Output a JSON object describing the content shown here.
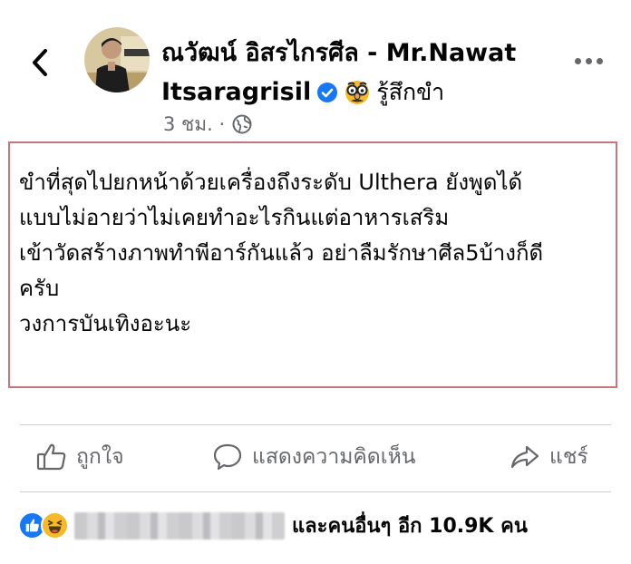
{
  "post": {
    "author_line1": "ณวัฒน์ อิสรไกรศีล - Mr.Nawat",
    "author_line2": "Itsaragrisil",
    "feeling": "รู้สึกขำ",
    "time": "3 ชม. ·",
    "lines": [
      "ขำที่สุดไปยกหน้าด้วยเครื่องถึงระดับ Ulthera ยังพูดได้",
      "แบบไม่อายว่าไม่เคยทำอะไรกินแต่อาหารเสริม",
      "เข้าวัดสร้างภาพทำพีอาร์กันแล้ว อย่าลืมรักษาศีล5บ้างก็ดี",
      "ครับ",
      "วงการบันเทิงอะนะ"
    ]
  },
  "icons": {
    "back": "chevron-left-icon",
    "verified": "verified-badge-icon",
    "feeling": "disguise-face-emoji-icon",
    "privacy": "globe-icon",
    "more": "more-dots-icon",
    "like": "thumbs-up-icon",
    "comment": "comment-bubble-icon",
    "share": "share-arrow-icon",
    "reaction_like": "like-reaction-icon",
    "reaction_haha": "haha-reaction-icon"
  },
  "actions": {
    "like": "ถูกใจ",
    "comment": "แสดงความคิดเห็น",
    "share": "แชร์"
  },
  "reactions": {
    "others_text": "และคนอื่นๆ อีก 10.9K คน"
  },
  "colors": {
    "verified": "#1877f2",
    "like_blue": "#1877f2",
    "haha_yellow": "#f7b928",
    "post_border": "#c9757a",
    "secondary_text": "#65676b"
  }
}
